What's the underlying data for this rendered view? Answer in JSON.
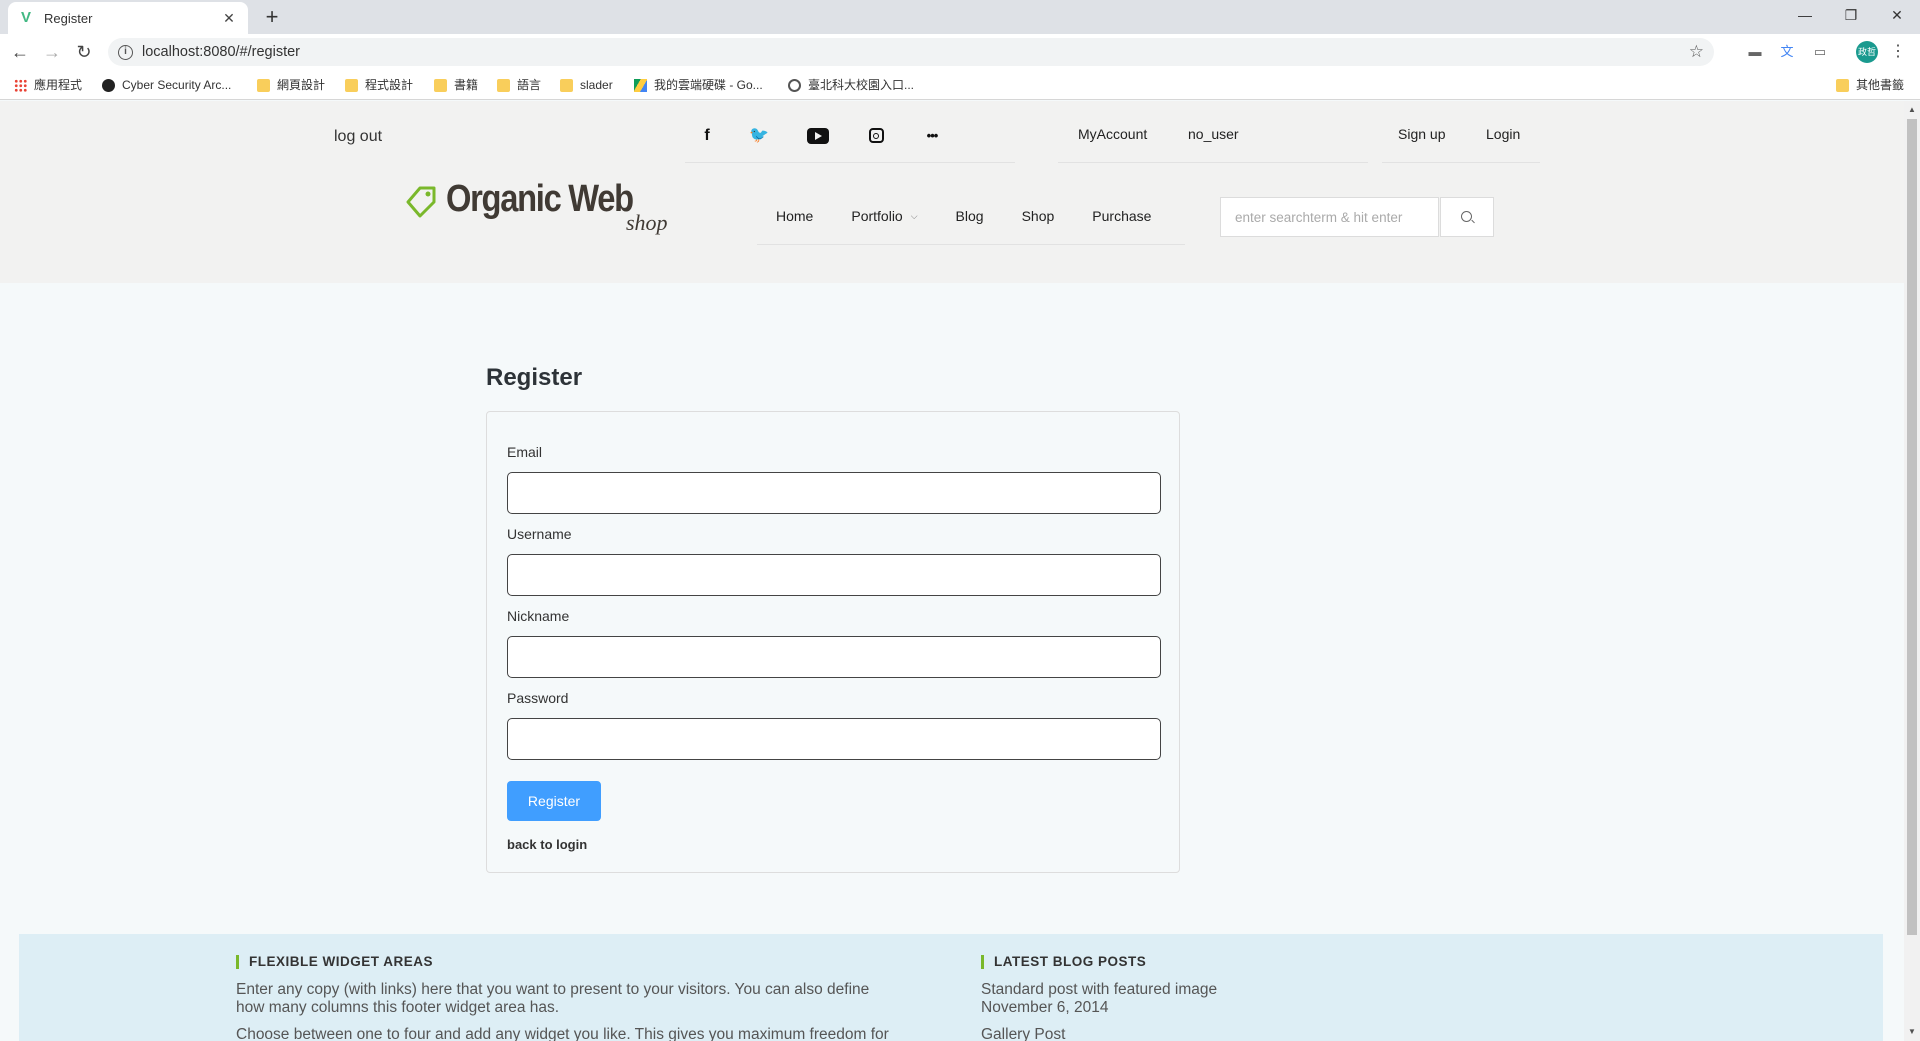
{
  "browser": {
    "tab_title": "Register",
    "tab_favicon": "V",
    "new_tab": "+",
    "url": "localhost:8080/#/register",
    "avatar_text": "政哲",
    "bookmarks": [
      {
        "label": "應用程式",
        "icon": "apps-icon"
      },
      {
        "label": "Cyber Security Arc...",
        "icon": "site-icon"
      },
      {
        "label": "網頁設計",
        "icon": "folder-icon"
      },
      {
        "label": "程式設計",
        "icon": "folder-icon"
      },
      {
        "label": "書籍",
        "icon": "folder-icon"
      },
      {
        "label": "語言",
        "icon": "folder-icon"
      },
      {
        "label": "slader",
        "icon": "folder-icon"
      },
      {
        "label": "我的雲端硬碟 - Go...",
        "icon": "drive-icon"
      },
      {
        "label": "臺北科大校園入口...",
        "icon": "globe-icon"
      }
    ],
    "other_bookmarks": "其他書籤"
  },
  "header": {
    "logout": "log out",
    "more_label": "•••",
    "account": {
      "myaccount": "MyAccount",
      "user": "no_user"
    },
    "auth": {
      "signup": "Sign up",
      "login": "Login"
    },
    "logo": {
      "brand": "Organic Web",
      "sub": "shop"
    },
    "nav": [
      {
        "label": "Home"
      },
      {
        "label": "Portfolio",
        "caret": "⌵"
      },
      {
        "label": "Blog"
      },
      {
        "label": "Shop"
      },
      {
        "label": "Purchase"
      }
    ],
    "search": {
      "placeholder": "enter searchterm & hit enter"
    }
  },
  "form": {
    "title": "Register",
    "fields": [
      {
        "label": "Email",
        "value": ""
      },
      {
        "label": "Username",
        "value": ""
      },
      {
        "label": "Nickname",
        "value": ""
      },
      {
        "label": "Password",
        "value": ""
      }
    ],
    "submit": "Register",
    "back": "back to login"
  },
  "footer": {
    "widget1": {
      "title": "FLEXIBLE WIDGET AREAS",
      "text1": "Enter any copy (with links) here that you want to present to your visitors. You can also define",
      "text2": "how many columns this footer widget area has.",
      "text3": "Choose between one to four and add any widget you like. This gives you maximum freedom for"
    },
    "widget2": {
      "title": "LATEST BLOG POSTS",
      "post1_title": "Standard post with featured image",
      "post1_date": "November 6, 2014",
      "post2_title": "Gallery Post"
    }
  },
  "colors": {
    "accent": "#409eff",
    "logo_green": "#7ab82b",
    "footer_bg": "#ddeef5"
  }
}
